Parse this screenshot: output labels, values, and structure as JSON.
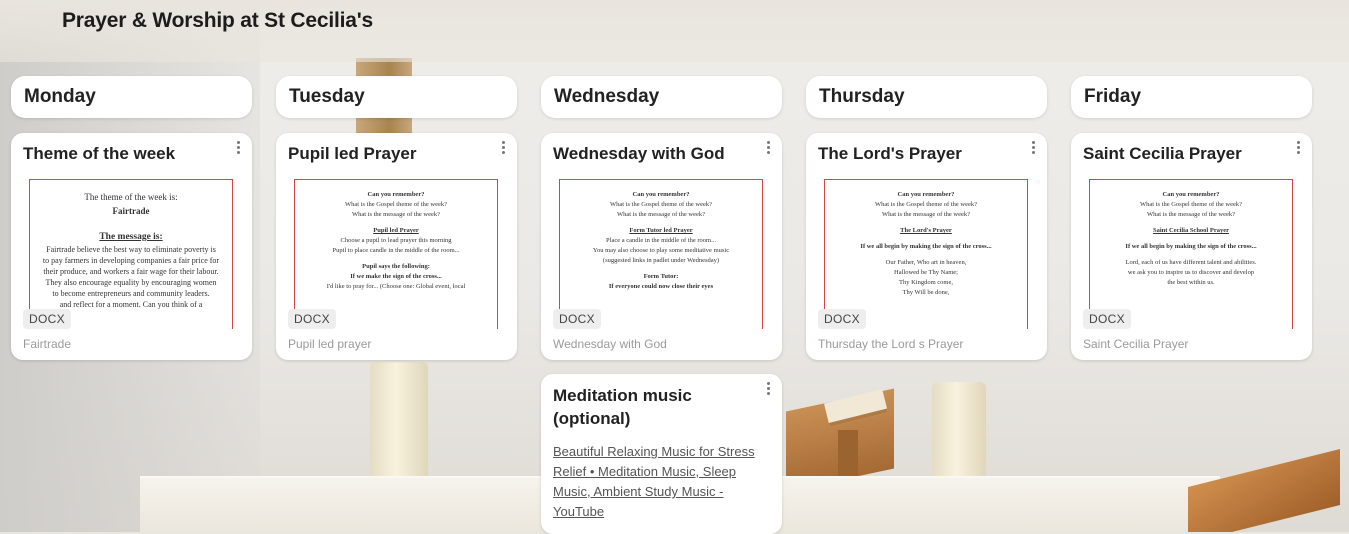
{
  "page_title": "Prayer & Worship at St Cecilia's",
  "columns": [
    {
      "title": "Monday",
      "card": {
        "title": "Theme of the week",
        "file_type": "DOCX",
        "caption": "Fairtrade",
        "preview_lines": [
          "The theme of the week is:",
          "Fairtrade",
          "The message is:",
          "Fairtrade believe the best way to eliminate poverty is",
          "to pay farmers in developing companies a fair price for",
          "their produce, and workers a fair wage for their labour.",
          "They also encourage equality by encouraging women",
          "to become entrepreneurs and community leaders.",
          "and reflect for a moment. Can you think of a"
        ]
      }
    },
    {
      "title": "Tuesday",
      "card": {
        "title": "Pupil led Prayer",
        "file_type": "DOCX",
        "caption": "Pupil led prayer",
        "preview_lines": [
          "Can you remember?",
          "What is the Gospel theme of the week?",
          "What is the message of the week?",
          "Pupil led Prayer",
          "Choose a pupil to lead prayer this morning",
          "Pupil to place candle in the middle of the room...",
          "Pupil says the following:",
          "If we make the sign of the cross...",
          "I'd like to pray for... (Choose one: Global event, local"
        ]
      }
    },
    {
      "title": "Wednesday",
      "card": {
        "title": "Wednesday with God",
        "file_type": "DOCX",
        "caption": "Wednesday with God",
        "preview_lines": [
          "Can you remember?",
          "What is the Gospel theme of the week?",
          "What is the message of the week?",
          "Form Tutor led Prayer",
          "Place a candle in the middle of the room...",
          "You may also choose to play some meditative music",
          "(suggested links in padlet under Wednesday)",
          "Form Tutor:",
          "If everyone could now close their eyes"
        ]
      },
      "link_card": {
        "title": "Meditation music (optional)",
        "link_text": "Beautiful Relaxing Music for Stress Relief • Meditation Music, Sleep Music, Ambient Study Music - YouTube"
      }
    },
    {
      "title": "Thursday",
      "card": {
        "title": "The Lord's Prayer",
        "file_type": "DOCX",
        "caption": "Thursday the Lord s Prayer",
        "preview_lines": [
          "Can you remember?",
          "What is the Gospel theme of the week?",
          "What is the message of the week?",
          "The Lord's Prayer",
          "If we all begin by making the sign of the cross...",
          "Our Father, Who art in heaven,",
          "Hallowed be Thy Name;",
          "Thy Kingdom come,",
          "Thy Will be done,"
        ]
      }
    },
    {
      "title": "Friday",
      "card": {
        "title": "Saint Cecilia Prayer",
        "file_type": "DOCX",
        "caption": "Saint Cecilia Prayer",
        "preview_lines": [
          "Can you remember?",
          "What is the Gospel theme of the week?",
          "What is the message of the week?",
          "Saint Cecilia School Prayer",
          "If we all begin by making the sign of the cross...",
          "Lord, each of us have different talent and abilities.",
          "we ask you to inspire us to discover and develop",
          "the best within us."
        ]
      }
    }
  ]
}
